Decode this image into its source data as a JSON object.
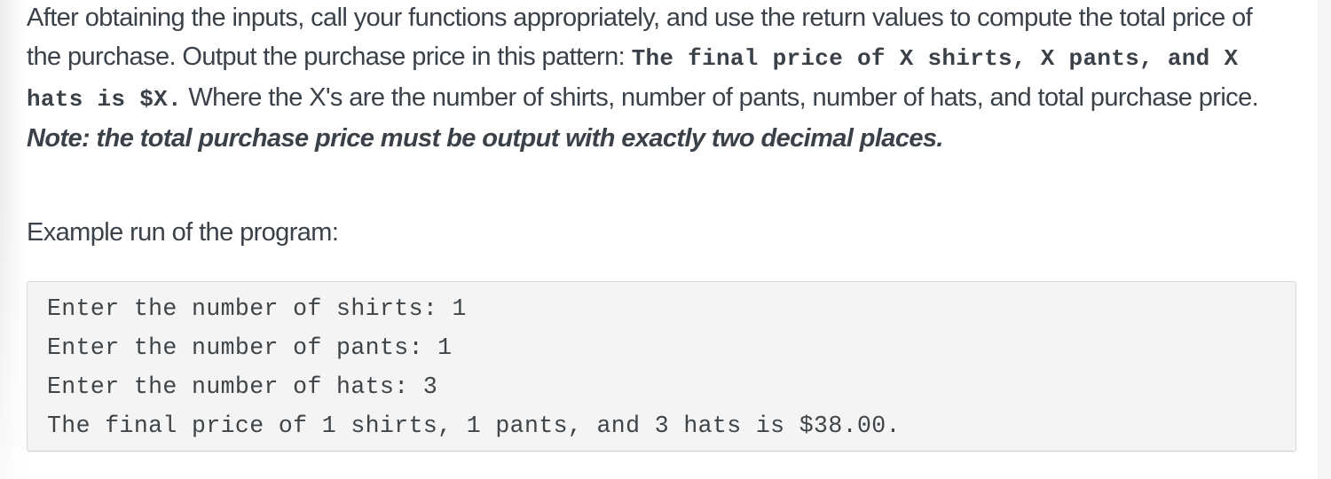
{
  "instructions": {
    "text_before_pattern": "After obtaining the inputs, call your functions appropriately, and use the return values to compute the total price of the purchase. Output the purchase price in this pattern: ",
    "pattern": "The final price of X shirts, X pants, and X hats is $X.",
    "text_after_pattern": " Where the X's are the number of shirts, number of pants, number of hats, and total purchase price. ",
    "note": "Note: the total purchase price must be output with exactly two decimal places."
  },
  "example": {
    "label": "Example run of the program:",
    "lines": [
      "Enter the number of shirts: 1",
      "Enter the number of pants: 1",
      "Enter the number of hats: 3",
      "The final price of 1 shirts, 1 pants, and 3 hats is $38.00."
    ]
  }
}
